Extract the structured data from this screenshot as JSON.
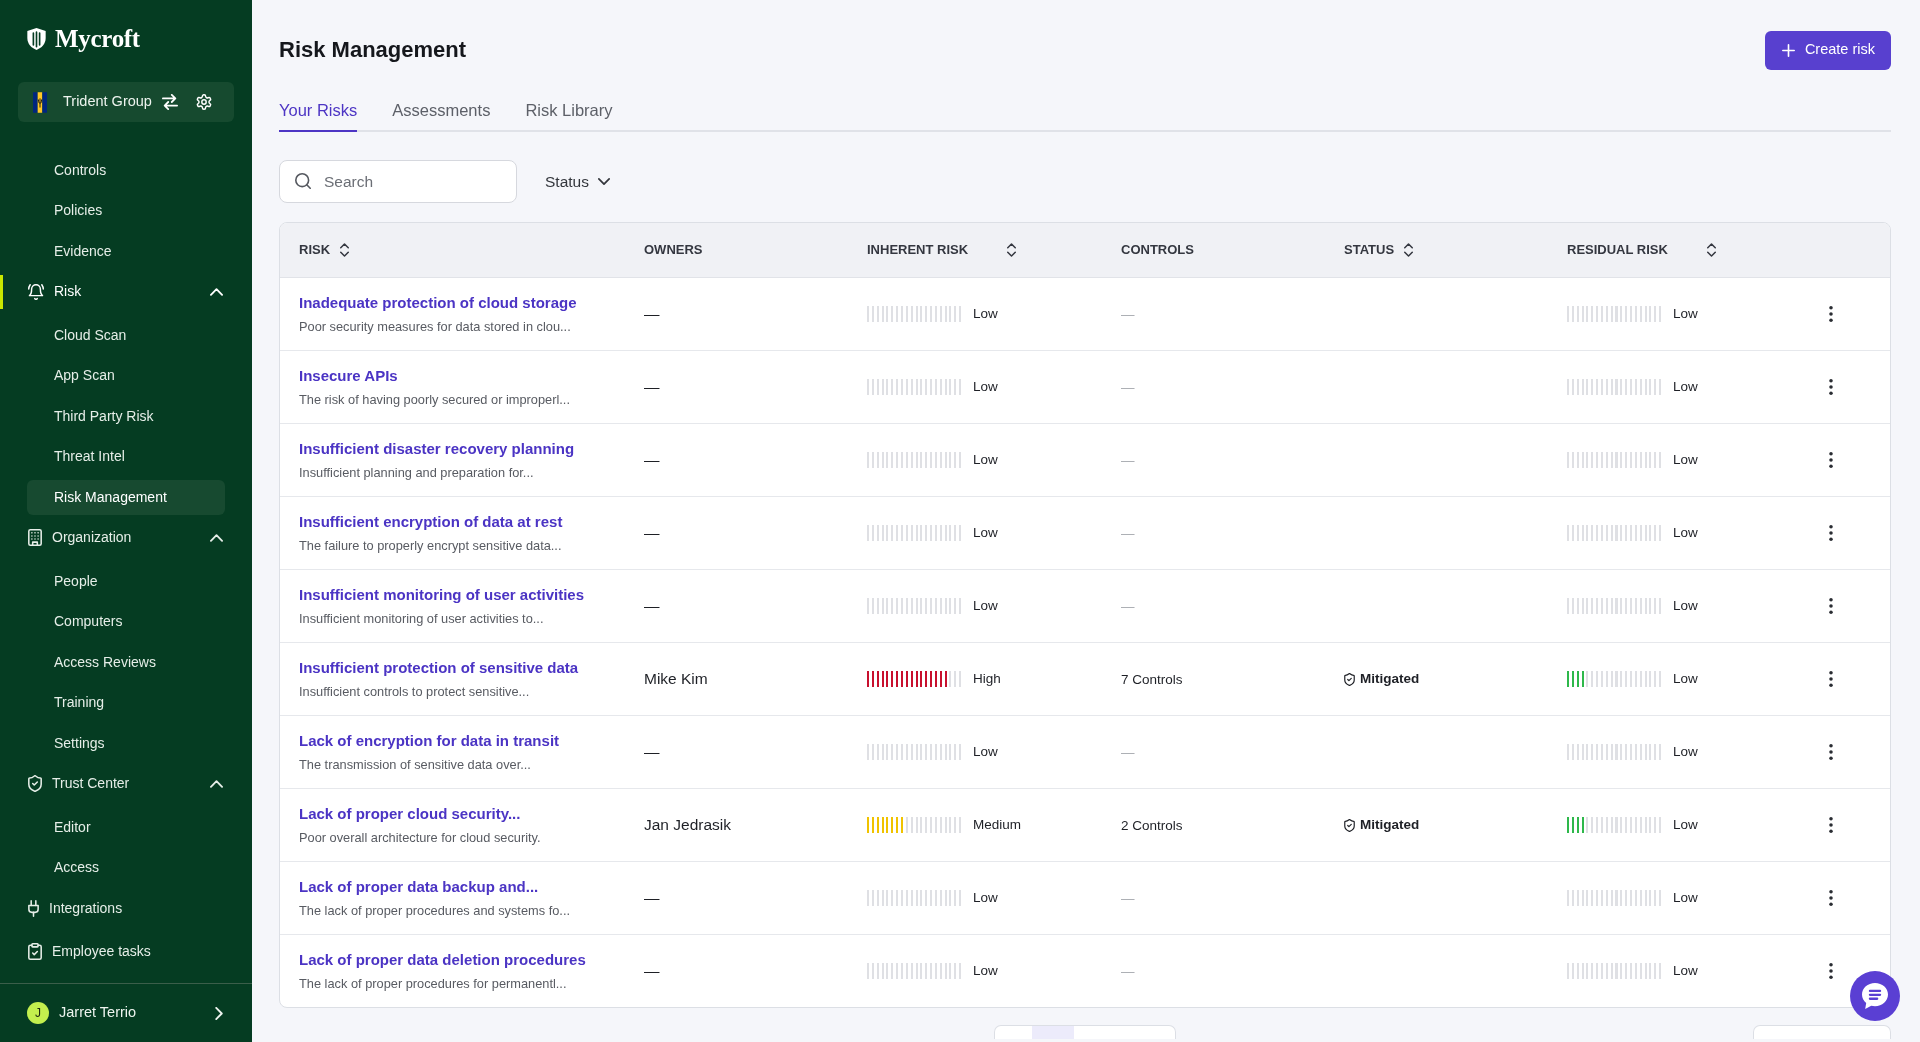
{
  "sidebar": {
    "logo": "Mycroft",
    "org": {
      "name": "Trident Group"
    },
    "nav": [
      {
        "kind": "item",
        "label": "Controls",
        "selected": false
      },
      {
        "kind": "item",
        "label": "Policies",
        "selected": false
      },
      {
        "kind": "item",
        "label": "Evidence",
        "selected": false
      },
      {
        "kind": "group",
        "label": "Risk",
        "selected": true,
        "expanded": true,
        "children": [
          {
            "label": "Cloud Scan",
            "selected": false
          },
          {
            "label": "App Scan",
            "selected": false
          },
          {
            "label": "Third Party Risk",
            "selected": false
          },
          {
            "label": "Threat Intel",
            "selected": false
          },
          {
            "label": "Risk Management",
            "selected": true
          }
        ]
      },
      {
        "kind": "group",
        "label": "Organization",
        "selected": false,
        "expanded": true,
        "children": [
          {
            "label": "People",
            "selected": false
          },
          {
            "label": "Computers",
            "selected": false
          },
          {
            "label": "Access Reviews",
            "selected": false
          },
          {
            "label": "Training",
            "selected": false
          },
          {
            "label": "Settings",
            "selected": false
          }
        ]
      },
      {
        "kind": "group",
        "label": "Trust Center",
        "selected": false,
        "expanded": true,
        "children": [
          {
            "label": "Editor",
            "selected": false
          },
          {
            "label": "Access",
            "selected": false
          }
        ]
      },
      {
        "kind": "link",
        "label": "Integrations",
        "selected": false
      },
      {
        "kind": "link",
        "label": "Employee tasks",
        "selected": false
      }
    ],
    "user": {
      "initial": "J",
      "name": "Jarret Terrio"
    }
  },
  "header": {
    "title": "Risk Management",
    "create_button": "Create risk"
  },
  "tabs": [
    {
      "label": "Your Risks",
      "selected": true
    },
    {
      "label": "Assessments",
      "selected": false
    },
    {
      "label": "Risk Library",
      "selected": false
    }
  ],
  "filters": {
    "search": {
      "placeholder": "Search"
    },
    "status": {
      "label": "Status"
    }
  },
  "table": {
    "columns": [
      {
        "label": "RISK",
        "sortable": true
      },
      {
        "label": "OWNERS",
        "sortable": false
      },
      {
        "label": "INHERENT RISK",
        "sortable": true
      },
      {
        "label": "CONTROLS",
        "sortable": false
      },
      {
        "label": "STATUS",
        "sortable": true
      },
      {
        "label": "RESIDUAL RISK",
        "sortable": true
      }
    ],
    "rows": [
      {
        "title": "Inadequate protection of cloud storage",
        "description": "Poor security measures for data stored in clou...",
        "owner": "—",
        "inherent": {
          "level": 0,
          "rating": "Low"
        },
        "controls": {
          "text": "—",
          "muted": true
        },
        "residual": {
          "level": 0,
          "rating": "Low"
        }
      },
      {
        "title": "Insecure APIs",
        "description": "The risk of having poorly secured or improperl...",
        "owner": "—",
        "inherent": {
          "level": 0,
          "rating": "Low"
        },
        "controls": {
          "text": "—",
          "muted": true
        },
        "residual": {
          "level": 0,
          "rating": "Low"
        }
      },
      {
        "title": "Insufficient disaster recovery planning",
        "description": "Insufficient planning and preparation for...",
        "owner": "—",
        "inherent": {
          "level": 0,
          "rating": "Low"
        },
        "controls": {
          "text": "—",
          "muted": true
        },
        "residual": {
          "level": 0,
          "rating": "Low"
        }
      },
      {
        "title": "Insufficient encryption of data at rest",
        "description": "The failure to properly encrypt sensitive data...",
        "owner": "—",
        "inherent": {
          "level": 0,
          "rating": "Low"
        },
        "controls": {
          "text": "—",
          "muted": true
        },
        "residual": {
          "level": 0,
          "rating": "Low"
        }
      },
      {
        "title": "Insufficient monitoring of user activities",
        "description": "Insufficient monitoring of user activities to...",
        "owner": "—",
        "inherent": {
          "level": 0,
          "rating": "Low"
        },
        "controls": {
          "text": "—",
          "muted": true
        },
        "residual": {
          "level": 0,
          "rating": "Low"
        }
      },
      {
        "title": "Insufficient protection of sensitive data",
        "description": "Insufficient controls to protect sensitive...",
        "owner": "Mike Kim",
        "inherent": {
          "level": 0.85,
          "rating": "High"
        },
        "controls": {
          "text": "7 Controls",
          "muted": false
        },
        "status": "Mitigated",
        "residual": {
          "level": 0.2,
          "rating": "Low"
        }
      },
      {
        "title": "Lack of encryption for data in transit",
        "description": "The transmission of sensitive data over...",
        "owner": "—",
        "inherent": {
          "level": 0,
          "rating": "Low"
        },
        "controls": {
          "text": "—",
          "muted": true
        },
        "residual": {
          "level": 0,
          "rating": "Low"
        }
      },
      {
        "title": "Lack of proper cloud security...",
        "description": "Poor overall architecture for cloud security.",
        "owner": "Jan Jedrasik",
        "inherent": {
          "level": 0.4,
          "rating": "Medium"
        },
        "controls": {
          "text": "2 Controls",
          "muted": false
        },
        "status": "Mitigated",
        "residual": {
          "level": 0.2,
          "rating": "Low"
        }
      },
      {
        "title": "Lack of proper data backup and...",
        "description": "The lack of proper procedures and systems fo...",
        "owner": "—",
        "inherent": {
          "level": 0,
          "rating": "Low"
        },
        "controls": {
          "text": "—",
          "muted": true
        },
        "residual": {
          "level": 0,
          "rating": "Low"
        }
      },
      {
        "title": "Lack of proper data deletion procedures",
        "description": "The lack of proper procedures for permanentl...",
        "owner": "—",
        "inherent": {
          "level": 0,
          "rating": "Low"
        },
        "controls": {
          "text": "—",
          "muted": true
        },
        "residual": {
          "level": 0,
          "rating": "Low"
        }
      }
    ]
  }
}
